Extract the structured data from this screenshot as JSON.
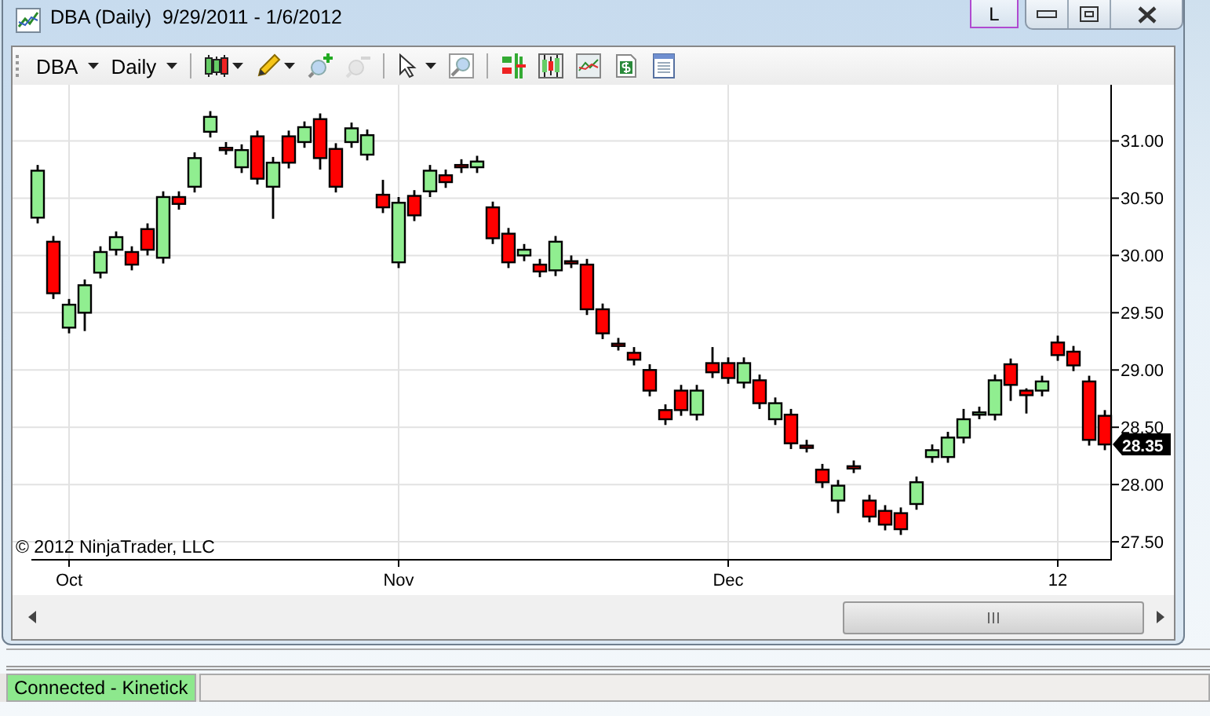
{
  "window": {
    "title": "DBA (Daily)  9/29/2011 - 1/6/2012",
    "link_button": "L"
  },
  "toolbar": {
    "items": [
      {
        "kind": "dropdown",
        "label": "DBA"
      },
      {
        "kind": "dropdown",
        "label": "Daily"
      },
      {
        "kind": "separator"
      },
      {
        "kind": "icon",
        "caret": true,
        "disabled": false
      },
      {
        "kind": "icon",
        "caret": true,
        "disabled": false
      },
      {
        "kind": "icon",
        "caret": false,
        "disabled": false
      },
      {
        "kind": "icon",
        "caret": false,
        "disabled": true
      },
      {
        "kind": "separator"
      },
      {
        "kind": "icon",
        "caret": true,
        "disabled": false
      },
      {
        "kind": "icon",
        "caret": false,
        "disabled": false
      },
      {
        "kind": "separator"
      },
      {
        "kind": "icon",
        "caret": false,
        "disabled": false
      },
      {
        "kind": "icon",
        "caret": false,
        "disabled": false
      },
      {
        "kind": "icon",
        "caret": false,
        "disabled": false
      },
      {
        "kind": "icon",
        "caret": false,
        "disabled": false
      },
      {
        "kind": "icon",
        "caret": false,
        "disabled": false
      }
    ]
  },
  "chart": {
    "copyright": "© 2012 NinjaTrader, LLC",
    "last_price": "28.35",
    "chart_data": {
      "type": "candlestick",
      "grid": true,
      "ylim": [
        27.35,
        31.49
      ],
      "yticks": [
        {
          "value": 27.5,
          "label": "27.50"
        },
        {
          "value": 28,
          "label": "28.00"
        },
        {
          "value": 28.5,
          "label": "28.50"
        },
        {
          "value": 29,
          "label": "29.00"
        },
        {
          "value": 29.5,
          "label": "29.50"
        },
        {
          "value": 30,
          "label": "30.00"
        },
        {
          "value": 30.5,
          "label": "30.50"
        },
        {
          "value": 31,
          "label": "31.00"
        }
      ],
      "categories": [
        null,
        null,
        "Oct",
        null,
        null,
        null,
        null,
        null,
        null,
        null,
        null,
        null,
        null,
        null,
        null,
        null,
        null,
        null,
        null,
        null,
        null,
        null,
        null,
        "Nov",
        null,
        null,
        null,
        null,
        null,
        null,
        null,
        null,
        null,
        null,
        null,
        null,
        null,
        null,
        null,
        null,
        null,
        null,
        null,
        null,
        "Dec",
        null,
        null,
        null,
        null,
        null,
        null,
        null,
        null,
        null,
        null,
        null,
        null,
        null,
        null,
        null,
        null,
        null,
        null,
        null,
        null,
        "12",
        null,
        null,
        null
      ],
      "ohlc": [
        [
          30.33,
          30.79,
          30.28,
          30.74
        ],
        [
          30.12,
          30.17,
          29.62,
          29.67
        ],
        [
          29.37,
          29.62,
          29.32,
          29.57
        ],
        [
          29.5,
          29.79,
          29.34,
          29.74
        ],
        [
          29.85,
          30.08,
          29.8,
          30.03
        ],
        [
          30.05,
          30.21,
          30.0,
          30.16
        ],
        [
          30.03,
          30.08,
          29.87,
          29.92
        ],
        [
          30.23,
          30.28,
          30.0,
          30.05
        ],
        [
          29.98,
          30.56,
          29.93,
          30.51
        ],
        [
          30.51,
          30.56,
          30.4,
          30.45
        ],
        [
          30.6,
          30.9,
          30.55,
          30.85
        ],
        [
          31.08,
          31.26,
          31.03,
          31.21
        ],
        [
          30.94,
          30.99,
          30.88,
          30.93
        ],
        [
          30.77,
          30.97,
          30.72,
          30.92
        ],
        [
          31.04,
          31.09,
          30.62,
          30.67
        ],
        [
          30.6,
          30.86,
          30.32,
          30.81
        ],
        [
          31.04,
          31.09,
          30.76,
          30.81
        ],
        [
          30.99,
          31.17,
          30.94,
          31.12
        ],
        [
          31.19,
          31.24,
          30.75,
          30.85
        ],
        [
          30.93,
          30.98,
          30.55,
          30.6
        ],
        [
          30.99,
          31.16,
          30.94,
          31.11
        ],
        [
          30.88,
          31.1,
          30.83,
          31.05
        ],
        [
          30.53,
          30.66,
          30.37,
          30.42
        ],
        [
          29.94,
          30.51,
          29.89,
          30.46
        ],
        [
          30.52,
          30.57,
          30.3,
          30.35
        ],
        [
          30.56,
          30.79,
          30.51,
          30.74
        ],
        [
          30.7,
          30.75,
          30.59,
          30.64
        ],
        [
          30.79,
          30.84,
          30.72,
          30.77
        ],
        [
          30.77,
          30.87,
          30.72,
          30.82
        ],
        [
          30.42,
          30.47,
          30.1,
          30.15
        ],
        [
          30.19,
          30.24,
          29.89,
          29.94
        ],
        [
          30.0,
          30.1,
          29.95,
          30.05
        ],
        [
          29.92,
          29.97,
          29.81,
          29.86
        ],
        [
          29.87,
          30.17,
          29.82,
          30.12
        ],
        [
          29.95,
          30.0,
          29.89,
          29.94
        ],
        [
          29.92,
          29.97,
          29.48,
          29.53
        ],
        [
          29.53,
          29.58,
          29.27,
          29.32
        ],
        [
          29.23,
          29.28,
          29.17,
          29.22
        ],
        [
          29.15,
          29.2,
          29.04,
          29.09
        ],
        [
          29.0,
          29.05,
          28.77,
          28.82
        ],
        [
          28.65,
          28.7,
          28.52,
          28.57
        ],
        [
          28.82,
          28.87,
          28.6,
          28.65
        ],
        [
          28.61,
          28.87,
          28.56,
          28.82
        ],
        [
          29.06,
          29.2,
          28.93,
          28.98
        ],
        [
          29.06,
          29.11,
          28.88,
          28.93
        ],
        [
          28.89,
          29.11,
          28.84,
          29.06
        ],
        [
          28.91,
          28.96,
          28.66,
          28.71
        ],
        [
          28.57,
          28.76,
          28.52,
          28.71
        ],
        [
          28.61,
          28.66,
          28.31,
          28.36
        ],
        [
          28.34,
          28.39,
          28.28,
          28.33
        ],
        [
          28.13,
          28.18,
          27.97,
          28.02
        ],
        [
          27.86,
          28.04,
          27.75,
          27.99
        ],
        [
          28.16,
          28.21,
          28.1,
          28.15
        ],
        [
          27.86,
          27.91,
          27.67,
          27.72
        ],
        [
          27.77,
          27.82,
          27.6,
          27.65
        ],
        [
          27.75,
          27.8,
          27.56,
          27.61
        ],
        [
          27.83,
          28.07,
          27.78,
          28.02
        ],
        [
          28.24,
          28.35,
          28.19,
          28.3
        ],
        [
          28.24,
          28.46,
          28.19,
          28.41
        ],
        [
          28.41,
          28.66,
          28.36,
          28.57
        ],
        [
          28.62,
          28.68,
          28.57,
          28.63
        ],
        [
          28.61,
          28.96,
          28.56,
          28.91
        ],
        [
          29.05,
          29.1,
          28.73,
          28.87
        ],
        [
          28.82,
          28.84,
          28.62,
          28.78
        ],
        [
          28.82,
          28.95,
          28.77,
          28.9
        ],
        [
          29.24,
          29.3,
          29.08,
          29.13
        ],
        [
          29.16,
          29.21,
          28.99,
          29.04
        ],
        [
          28.9,
          28.95,
          28.34,
          28.39
        ],
        [
          28.6,
          28.65,
          28.3,
          28.35
        ]
      ]
    }
  },
  "status_bar": {
    "connection": "Connected - Kinetick",
    "connected": true
  }
}
